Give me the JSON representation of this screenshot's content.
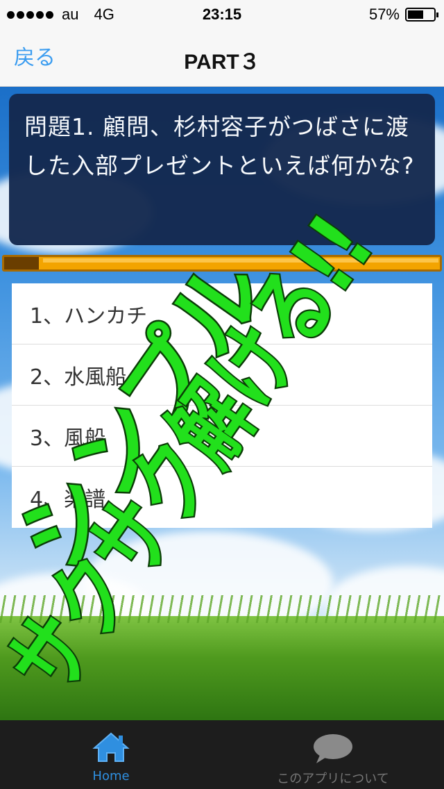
{
  "status_bar": {
    "carrier": "au",
    "network": "4G",
    "time": "23:15",
    "battery": "57%"
  },
  "nav": {
    "back_label": "戻る",
    "title": "PART３"
  },
  "question": {
    "text": "問題1. 顧問、杉村容子がつばさに渡した入部プレゼントといえば何かな?"
  },
  "timer": {
    "elapsed_fraction": 0.08
  },
  "answers": [
    {
      "label": "1、ハンカチ"
    },
    {
      "label": "2、水風船"
    },
    {
      "label": "3、風船"
    },
    {
      "label": "4、楽譜"
    }
  ],
  "promo": {
    "line1": "シンプル",
    "line2": "サクサク解ける!!",
    "color": "#22e01c"
  },
  "tabs": [
    {
      "label": "Home",
      "icon": "home-icon",
      "active": true
    },
    {
      "label": "このアプリについて",
      "icon": "speech-bubble-icon",
      "active": false
    }
  ],
  "colors": {
    "accent": "#2f8fe0",
    "question_bg": "#14294f",
    "timer_fill": "#f3a400"
  }
}
